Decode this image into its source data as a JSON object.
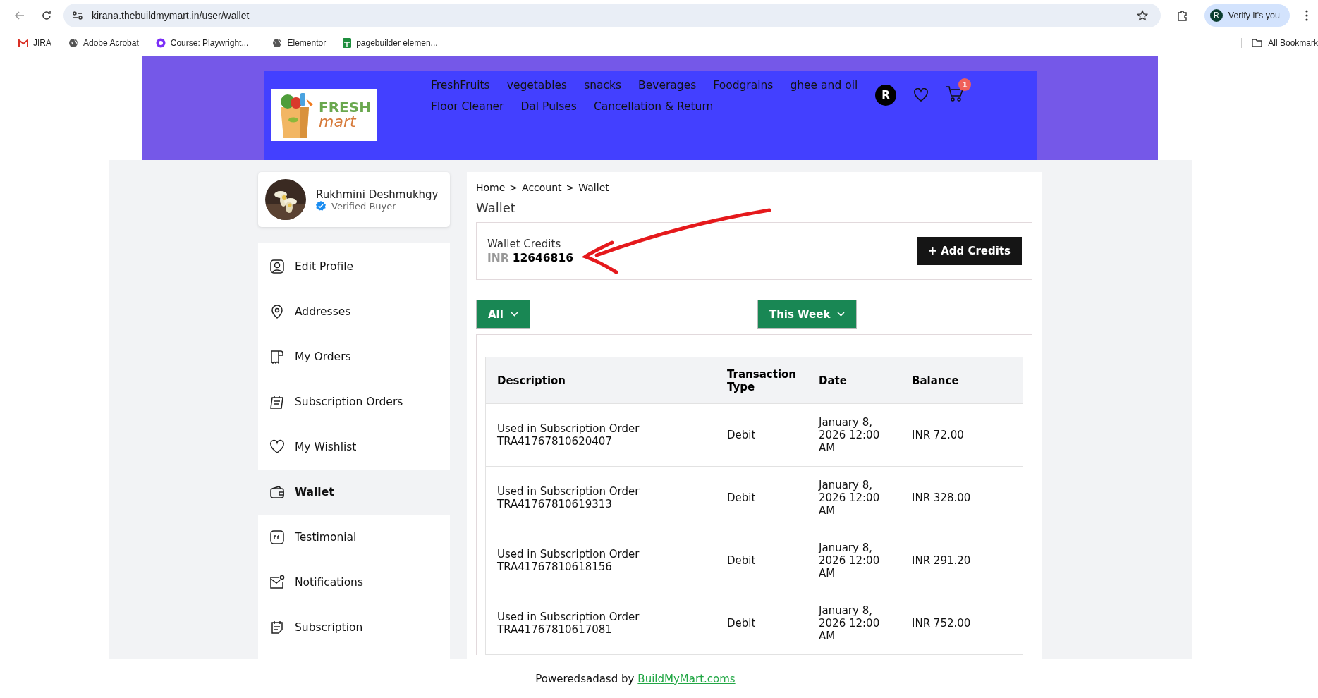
{
  "browser": {
    "url": "kirana.thebuildmymart.in/user/wallet",
    "profile_initial": "R",
    "profile_label": "Verify it's you",
    "bookmarks": [
      "JIRA",
      "Adobe Acrobat",
      "Course: Playwright...",
      "Elementor",
      "pagebuilder elemen..."
    ],
    "all_bookmarks": "All Bookmark"
  },
  "header": {
    "logo": {
      "line_1": "FRESH",
      "line_2": "mart"
    },
    "nav": [
      {
        "label": "FreshFruits"
      },
      {
        "label": "vegetables"
      },
      {
        "label": "snacks"
      },
      {
        "label": "Beverages"
      },
      {
        "label": "Foodgrains"
      },
      {
        "label": "ghee and oil"
      },
      {
        "label": "Floor Cleaner"
      },
      {
        "label": "Dal Pulses"
      },
      {
        "label": "Cancellation & Return"
      }
    ],
    "avatar_initial": "R",
    "cart_count": "1"
  },
  "profile": {
    "name": "Rukhmini Deshmukhgy",
    "badge": "Verified Buyer"
  },
  "sidebar": {
    "items": [
      {
        "label": "Edit Profile",
        "selected": false
      },
      {
        "label": "Addresses",
        "selected": false
      },
      {
        "label": "My Orders",
        "selected": false
      },
      {
        "label": "Subscription Orders",
        "selected": false
      },
      {
        "label": "My Wishlist",
        "selected": false
      },
      {
        "label": "Wallet",
        "selected": true
      },
      {
        "label": "Testimonial",
        "selected": false
      },
      {
        "label": "Notifications",
        "selected": false
      },
      {
        "label": "Subscription",
        "selected": false
      }
    ]
  },
  "breadcrumb": [
    "Home",
    "Account",
    "Wallet"
  ],
  "separator": ">",
  "title": "Wallet",
  "credits": {
    "label": "Wallet Credits",
    "currency": "INR",
    "amount": "12646816",
    "button": "+ Add Credits"
  },
  "filters": [
    {
      "label": "All"
    },
    {
      "label": "This Week"
    }
  ],
  "table": {
    "columns": [
      "Description",
      "Transaction Type",
      "Date",
      "Balance"
    ],
    "rows": [
      {
        "description": "Used in Subscription Order TRA41767810620407",
        "type": "Debit",
        "date": "January 8, 2026 12:00 AM",
        "balance": "INR 72.00"
      },
      {
        "description": "Used in Subscription Order TRA41767810619313",
        "type": "Debit",
        "date": "January 8, 2026 12:00 AM",
        "balance": "INR 328.00"
      },
      {
        "description": "Used in Subscription Order TRA41767810618156",
        "type": "Debit",
        "date": "January 8, 2026 12:00 AM",
        "balance": "INR 291.20"
      },
      {
        "description": "Used in Subscription Order TRA41767810617081",
        "type": "Debit",
        "date": "January 8, 2026 12:00 AM",
        "balance": "INR 752.00"
      }
    ]
  },
  "footer": {
    "text": "Poweredsadasd by",
    "link": "BuildMyMart.coms"
  }
}
